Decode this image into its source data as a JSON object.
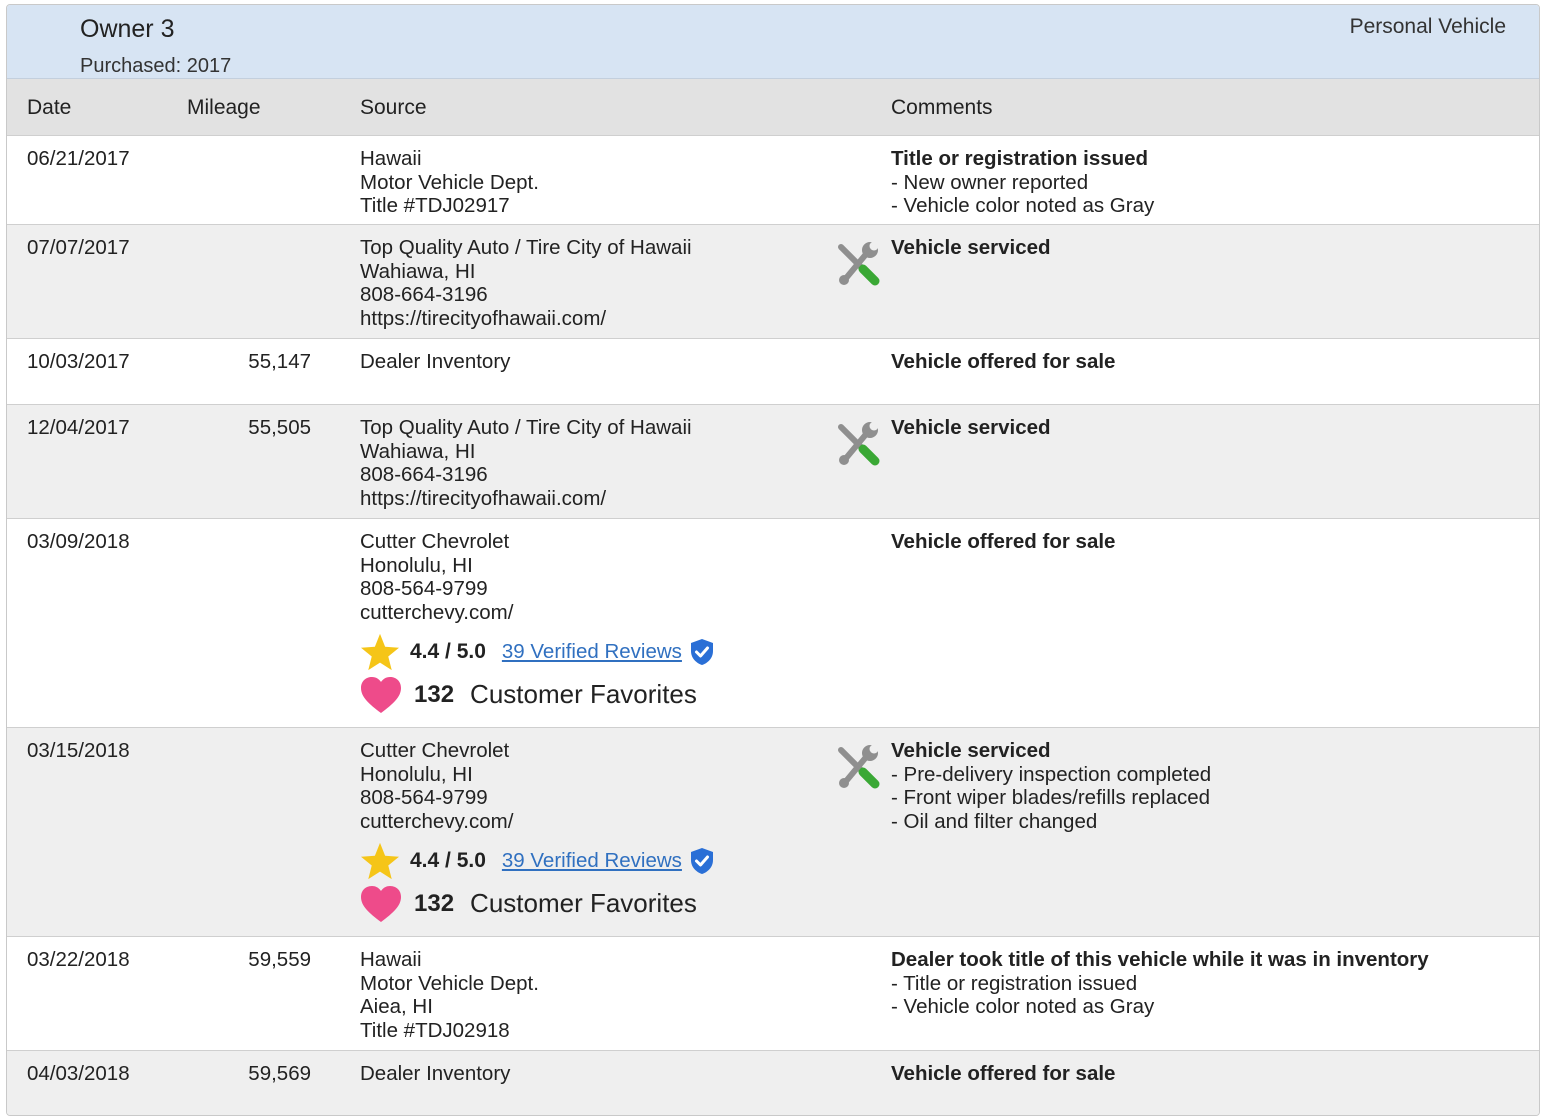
{
  "owner": {
    "title": "Owner 3",
    "purchased": "Purchased: 2017",
    "type": "Personal Vehicle"
  },
  "columns": {
    "date": "Date",
    "mileage": "Mileage",
    "source": "Source",
    "comments": "Comments"
  },
  "rows": [
    {
      "date": "06/21/2017",
      "mileage": "",
      "source": [
        "Hawaii",
        "Motor Vehicle Dept.",
        "Title #TDJ02917"
      ],
      "comment_head": "Title or registration issued",
      "comment_lines": [
        "- New owner reported",
        "- Vehicle color noted as Gray"
      ]
    },
    {
      "date": "07/07/2017",
      "mileage": "",
      "source": [
        "Top Quality Auto / Tire City of Hawaii",
        "Wahiawa, HI",
        "808-664-3196",
        "https://tirecityofhawaii.com/"
      ],
      "comment_head": "Vehicle serviced",
      "comment_lines": []
    },
    {
      "date": "10/03/2017",
      "mileage": "55,147",
      "source": [
        "Dealer Inventory"
      ],
      "comment_head": "Vehicle offered for sale",
      "comment_lines": []
    },
    {
      "date": "12/04/2017",
      "mileage": "55,505",
      "source": [
        "Top Quality Auto / Tire City of Hawaii",
        "Wahiawa, HI",
        "808-664-3196",
        "https://tirecityofhawaii.com/"
      ],
      "comment_head": "Vehicle serviced",
      "comment_lines": []
    },
    {
      "date": "03/09/2018",
      "mileage": "",
      "source": [
        "Cutter Chevrolet",
        "Honolulu, HI",
        "808-564-9799",
        "cutterchevy.com/"
      ],
      "rating": "4.4 / 5.0",
      "reviews": "39 Verified Reviews",
      "favorites_count": "132",
      "favorites_label": "Customer Favorites",
      "comment_head": "Vehicle offered for sale",
      "comment_lines": []
    },
    {
      "date": "03/15/2018",
      "mileage": "",
      "source": [
        "Cutter Chevrolet",
        "Honolulu, HI",
        "808-564-9799",
        "cutterchevy.com/"
      ],
      "rating": "4.4 / 5.0",
      "reviews": "39 Verified Reviews",
      "favorites_count": "132",
      "favorites_label": "Customer Favorites",
      "comment_head": "Vehicle serviced",
      "comment_lines": [
        "- Pre-delivery inspection completed",
        "- Front wiper blades/refills replaced",
        "- Oil and filter changed"
      ]
    },
    {
      "date": "03/22/2018",
      "mileage": "59,559",
      "source": [
        "Hawaii",
        "Motor Vehicle Dept.",
        "Aiea, HI",
        "Title #TDJ02918"
      ],
      "comment_head": "Dealer took title of this vehicle while it was in inventory",
      "comment_lines": [
        "- Title or registration issued",
        "- Vehicle color noted as Gray"
      ]
    },
    {
      "date": "04/03/2018",
      "mileage": "59,569",
      "source": [
        "Dealer Inventory"
      ],
      "comment_head": "Vehicle offered for sale",
      "comment_lines": []
    }
  ],
  "icons": {
    "service": "wrench-screwdriver-icon",
    "star": "star-icon",
    "verified": "shield-check-icon",
    "heart": "heart-icon"
  },
  "colors": {
    "header_bg": "#d7e4f3",
    "column_header_bg": "#e2e2e2",
    "shaded_row_bg": "#efefef",
    "link": "#3070c0",
    "star": "#f5c518",
    "heart": "#ee4b8a",
    "verified": "#2a6fd6",
    "screwdriver_handle": "#3aa835"
  }
}
